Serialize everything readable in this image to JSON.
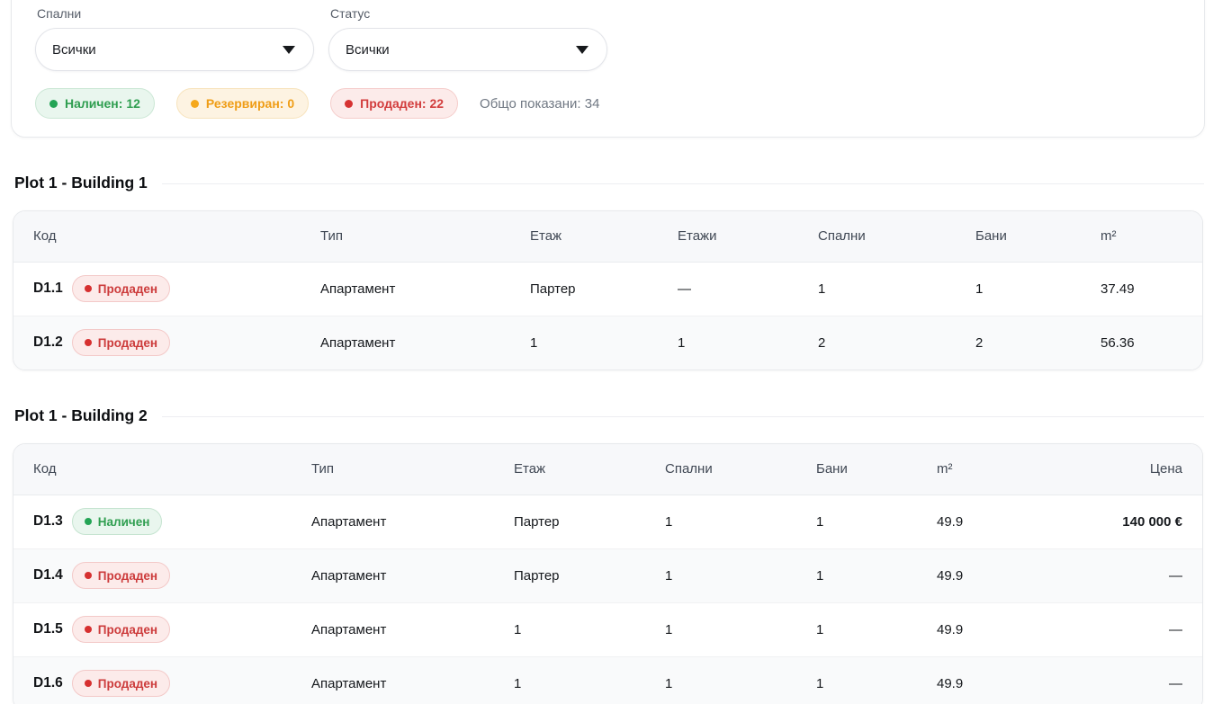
{
  "filters": {
    "bedrooms": {
      "label": "Спални",
      "value": "Всички"
    },
    "status": {
      "label": "Статус",
      "value": "Всички"
    }
  },
  "summary": {
    "available": "Наличен: 12",
    "reserved": "Резервиран: 0",
    "sold": "Продаден: 22",
    "total": "Общо показани: 34"
  },
  "colors": {
    "available_text": "#2f9e50",
    "available_bg": "#e9f6ee",
    "reserved_text": "#ef9d16",
    "reserved_bg": "#fdf3e2",
    "sold_text": "#d23c3c",
    "sold_bg": "#fcebea"
  },
  "sections": [
    {
      "title": "Plot 1 - Building 1",
      "columns": [
        "Код",
        "Тип",
        "Етаж",
        "Етажи",
        "Спални",
        "Бани",
        "m²"
      ],
      "rows": [
        {
          "code": "D1.1",
          "status": "sold",
          "status_label": "Продаден",
          "type": "Апартамент",
          "floor": "Партер",
          "floors": "—",
          "bedrooms": "1",
          "baths": "1",
          "area": "37.49"
        },
        {
          "code": "D1.2",
          "status": "sold",
          "status_label": "Продаден",
          "type": "Апартамент",
          "floor": "1",
          "floors": "1",
          "bedrooms": "2",
          "baths": "2",
          "area": "56.36"
        }
      ]
    },
    {
      "title": "Plot 1 - Building 2",
      "columns": [
        "Код",
        "Тип",
        "Етаж",
        "Спални",
        "Бани",
        "m²",
        "Цена"
      ],
      "rows": [
        {
          "code": "D1.3",
          "status": "available",
          "status_label": "Наличен",
          "type": "Апартамент",
          "floor": "Партер",
          "bedrooms": "1",
          "baths": "1",
          "area": "49.9",
          "price": "140 000 €"
        },
        {
          "code": "D1.4",
          "status": "sold",
          "status_label": "Продаден",
          "type": "Апартамент",
          "floor": "Партер",
          "bedrooms": "1",
          "baths": "1",
          "area": "49.9",
          "price": "—"
        },
        {
          "code": "D1.5",
          "status": "sold",
          "status_label": "Продаден",
          "type": "Апартамент",
          "floor": "1",
          "bedrooms": "1",
          "baths": "1",
          "area": "49.9",
          "price": "—"
        },
        {
          "code": "D1.6",
          "status": "sold",
          "status_label": "Продаден",
          "type": "Апартамент",
          "floor": "1",
          "bedrooms": "1",
          "baths": "1",
          "area": "49.9",
          "price": "—"
        }
      ]
    }
  ]
}
